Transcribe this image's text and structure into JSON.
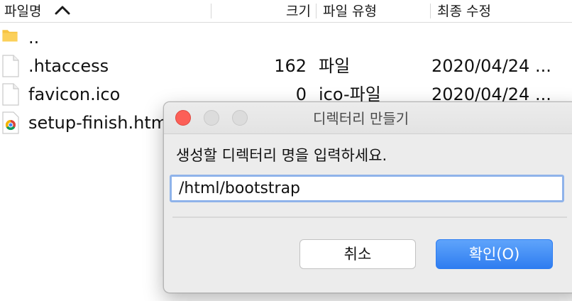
{
  "columns": {
    "name": "파일명",
    "size": "크기",
    "type": "파일 유형",
    "modified": "최종 수정"
  },
  "files": [
    {
      "icon": "folder-icon",
      "name": "..",
      "size": "",
      "type": "",
      "modified": ""
    },
    {
      "icon": "file-icon",
      "name": ".htaccess",
      "size": "162",
      "type": "파일",
      "modified": "2020/04/24 ..."
    },
    {
      "icon": "file-icon",
      "name": "favicon.ico",
      "size": "0",
      "type": "ico-파일",
      "modified": "2020/04/24 ..."
    },
    {
      "icon": "chrome-html-icon",
      "name": "setup-finish.html",
      "size": "",
      "type": "",
      "modified": ""
    }
  ],
  "dialog": {
    "title": "디렉터리 만들기",
    "prompt": "생성할 디렉터리 명을 입력하세요.",
    "input_value": "/html/bootstrap",
    "cancel_label": "취소",
    "ok_label": "확인(O)"
  },
  "colors": {
    "accent": "#2f7df0",
    "close": "#fc5f57",
    "folder": "#f6c342"
  }
}
